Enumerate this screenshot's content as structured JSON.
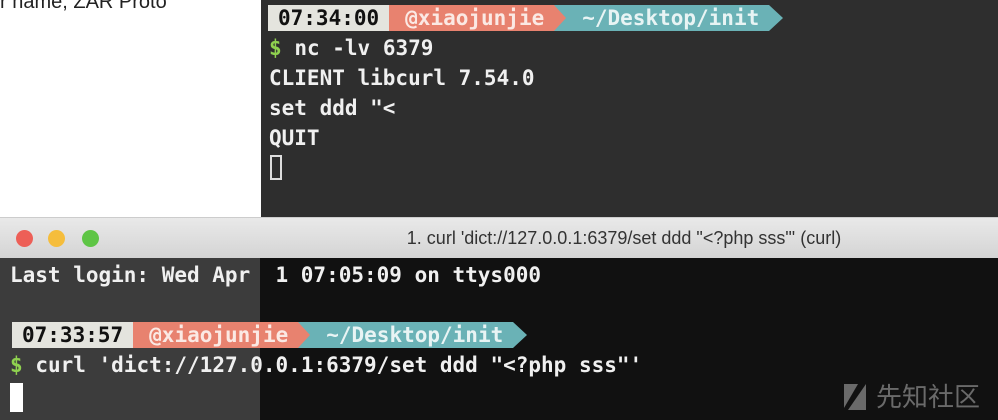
{
  "background_text": "r name,  ZAR Proto",
  "top_terminal": {
    "prompt": {
      "time": "07:34:00",
      "user": "@xiaojunjie",
      "path": "~/Desktop/init"
    },
    "dollar": "$",
    "command": "nc -lv 6379",
    "output": [
      "CLIENT libcurl 7.54.0",
      "set ddd \"<",
      "QUIT"
    ]
  },
  "bottom_terminal": {
    "title": "1. curl 'dict://127.0.0.1:6379/set ddd \"<?php sss\"' (curl)",
    "last_login": "Last login: Wed Apr  1 07:05:09 on ttys000",
    "prompt": {
      "time": "07:33:57",
      "user": "@xiaojunjie",
      "path": "~/Desktop/init"
    },
    "dollar": "$",
    "command": "curl 'dict://127.0.0.1:6379/set ddd \"<?php sss\"'"
  },
  "watermark": "先知社区",
  "colors": {
    "time_bg": "#e4e4de",
    "user_bg": "#e8826f",
    "path_bg": "#6ab2b6",
    "dollar": "#8fd14f"
  }
}
